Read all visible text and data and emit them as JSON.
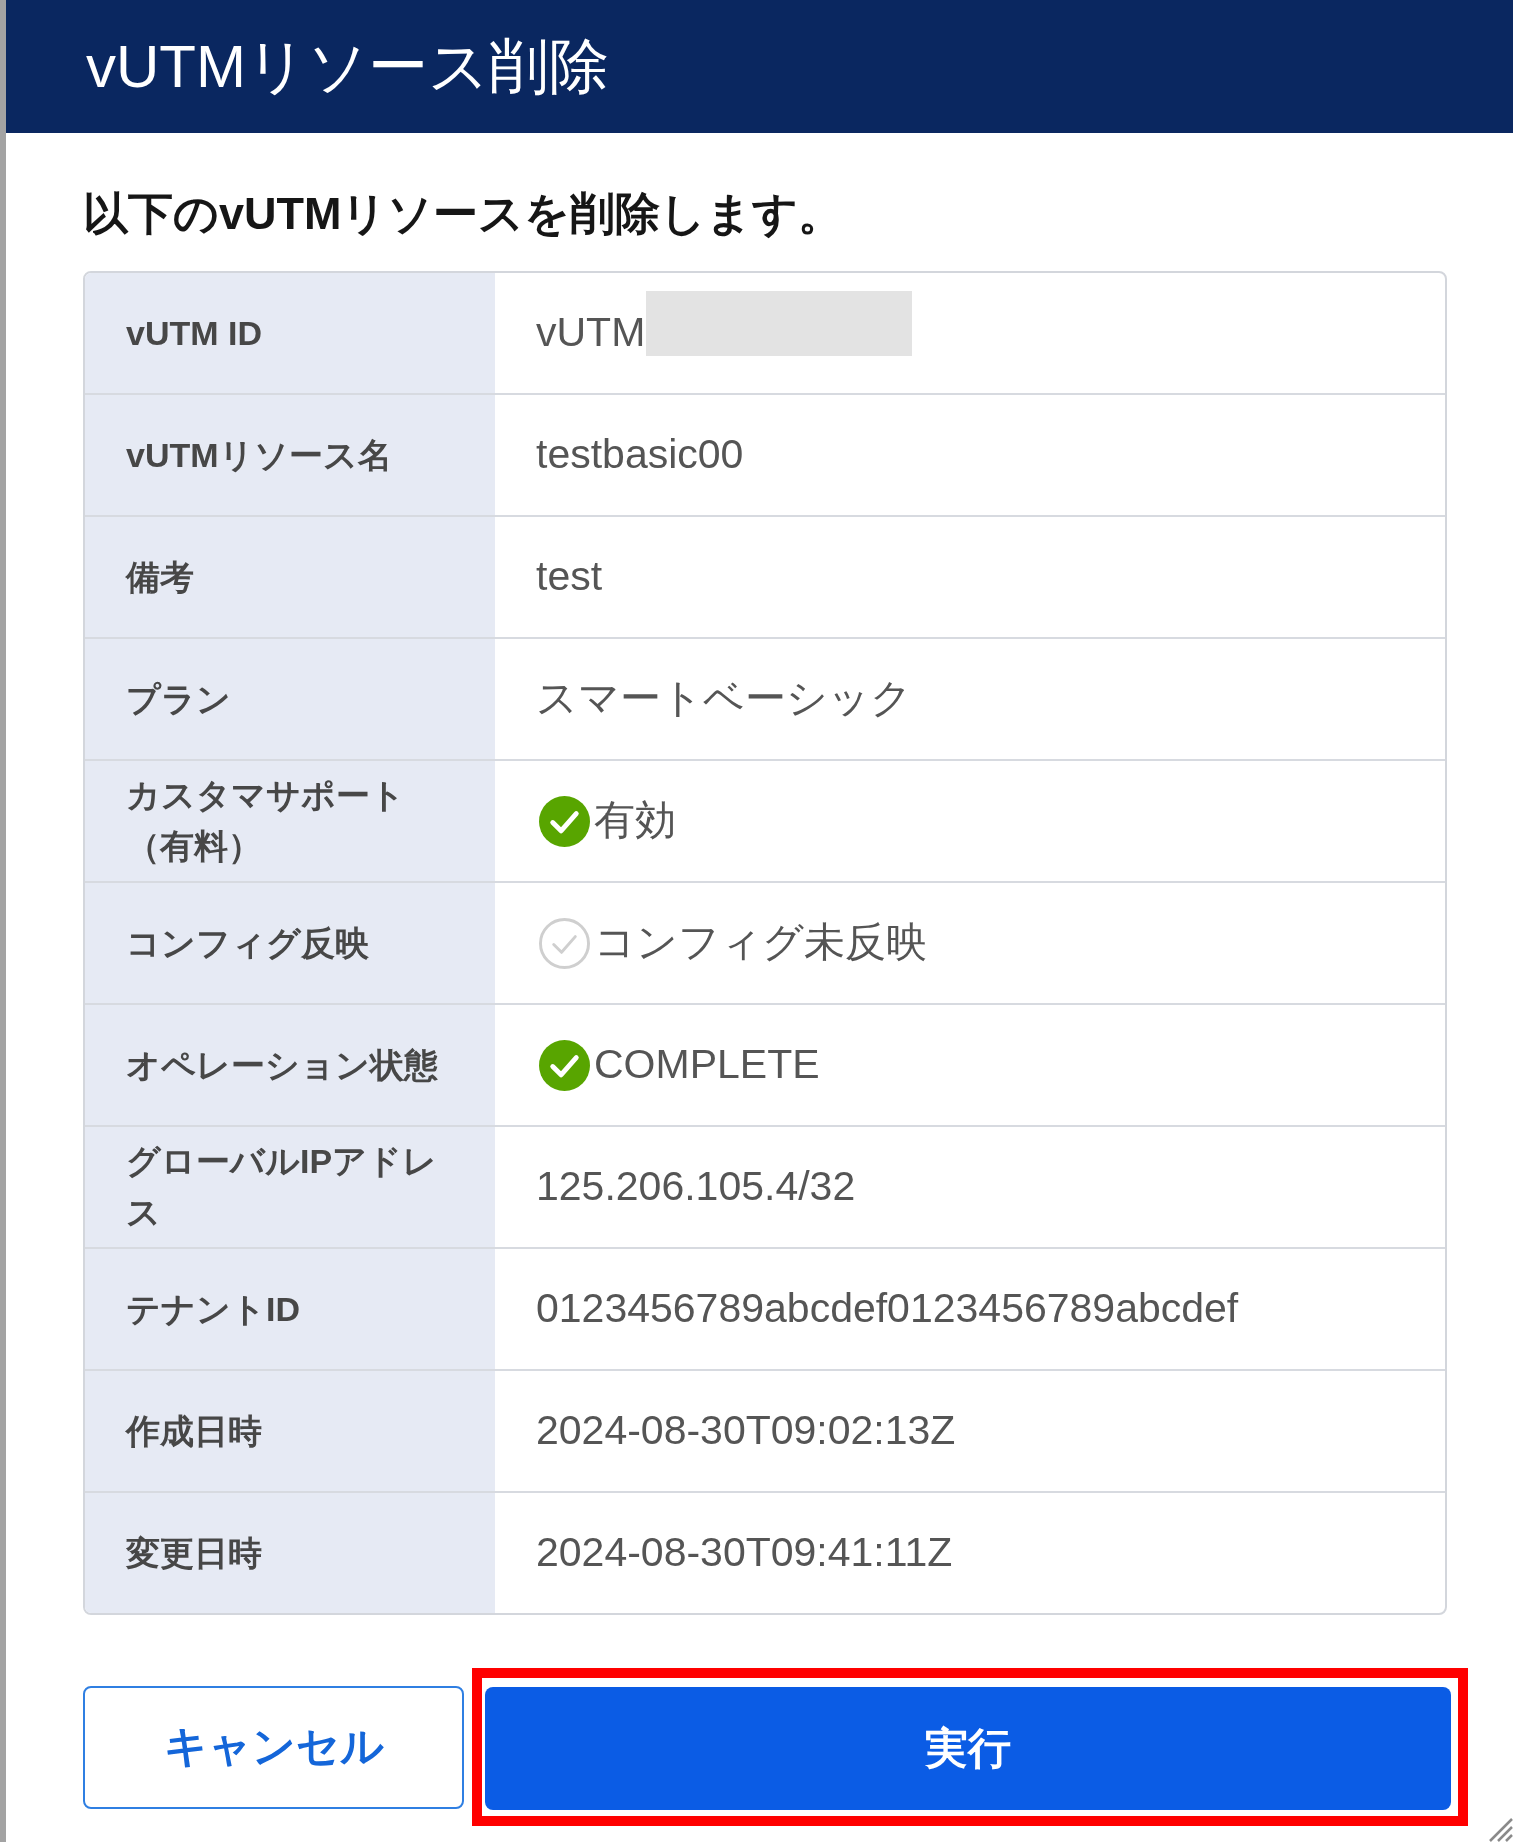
{
  "dialog": {
    "title": "vUTMリソース削除",
    "message": "以下のvUTMリソースを削除します。"
  },
  "details": [
    {
      "label": "vUTM ID",
      "value": "vUTM",
      "kind": "redacted"
    },
    {
      "label": "vUTMリソース名",
      "value": "testbasic00",
      "kind": "text"
    },
    {
      "label": "備考",
      "value": "test",
      "kind": "text"
    },
    {
      "label": "プラン",
      "value": "スマートベーシック",
      "kind": "text"
    },
    {
      "label": "カスタマサポート（有料）",
      "value": "有効",
      "kind": "status",
      "checked": true
    },
    {
      "label": "コンフィグ反映",
      "value": "コンフィグ未反映",
      "kind": "status",
      "checked": false
    },
    {
      "label": "オペレーション状態",
      "value": "COMPLETE",
      "kind": "status",
      "checked": true
    },
    {
      "label": "グローバルIPアドレス",
      "value": "125.206.105.4/32",
      "kind": "text"
    },
    {
      "label": "テナントID",
      "value": "0123456789abcdef0123456789abcdef",
      "kind": "text"
    },
    {
      "label": "作成日時",
      "value": "2024-08-30T09:02:13Z",
      "kind": "text"
    },
    {
      "label": "変更日時",
      "value": "2024-08-30T09:41:11Z",
      "kind": "text"
    }
  ],
  "buttons": [
    {
      "label": "キャンセル",
      "kind": "secondary",
      "highlighted": false
    },
    {
      "label": "実行",
      "kind": "primary",
      "highlighted": true
    }
  ]
}
